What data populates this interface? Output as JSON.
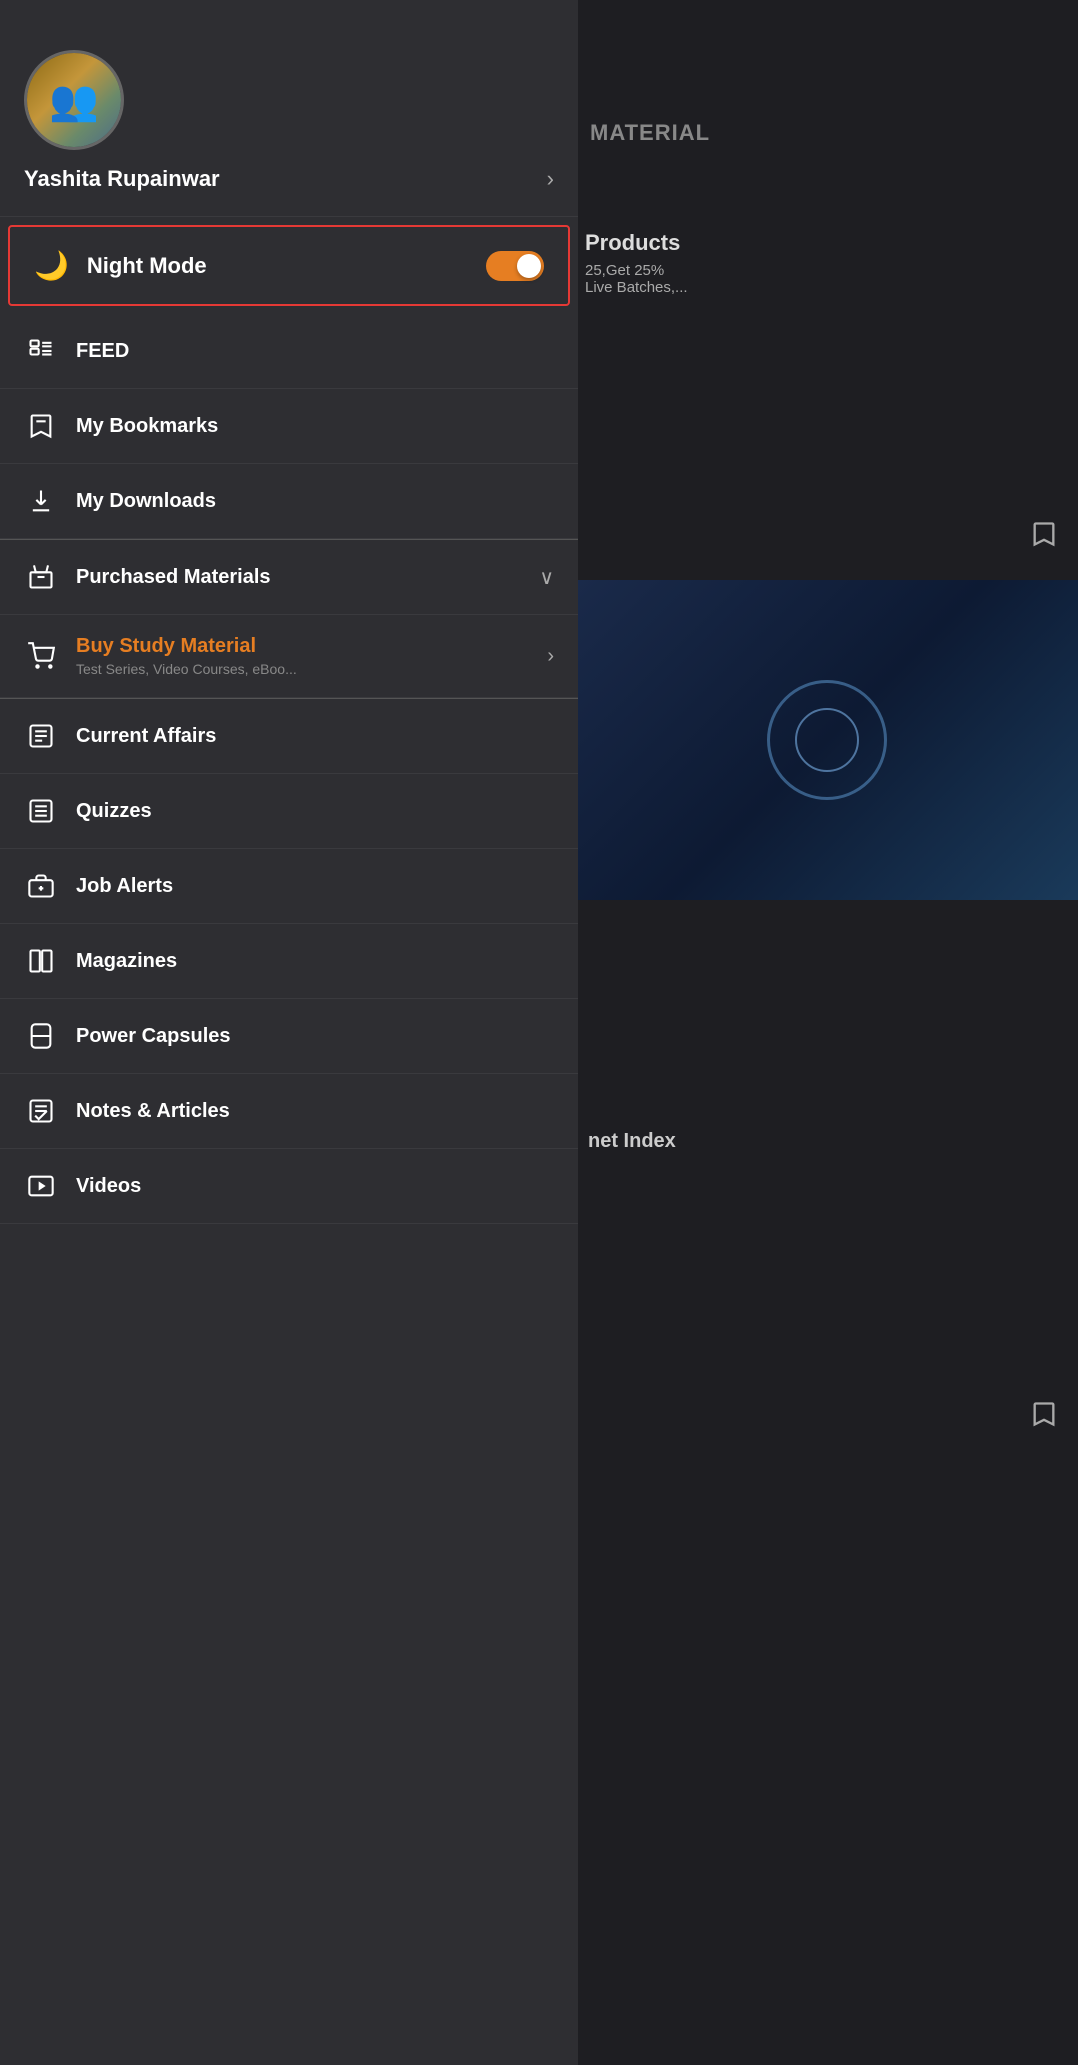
{
  "background": {
    "material_label": "MATERIAL",
    "products_title": "Products",
    "products_subtitle": "25,Get 25%\nLive Batches,...",
    "net_index": "net Index"
  },
  "profile": {
    "name": "Yashita Rupainwar",
    "chevron": "›"
  },
  "night_mode": {
    "label": "Night Mode",
    "toggle_state": "on"
  },
  "menu_items": [
    {
      "id": "feed",
      "label": "FEED",
      "icon": "feed",
      "has_chevron": false
    },
    {
      "id": "bookmarks",
      "label": "My Bookmarks",
      "icon": "bookmark",
      "has_chevron": false
    },
    {
      "id": "downloads",
      "label": "My Downloads",
      "icon": "download",
      "has_chevron": false
    },
    {
      "id": "purchased",
      "label": "Purchased Materials",
      "icon": "bag",
      "has_chevron": true,
      "chevron_type": "down"
    },
    {
      "id": "buy-study",
      "label": "Buy Study Material",
      "icon": "cart",
      "sublabel": "Test Series, Video Courses, eBoo...",
      "has_chevron": true,
      "chevron_type": "right",
      "orange": true
    },
    {
      "id": "current-affairs",
      "label": "Current Affairs",
      "icon": "newspaper",
      "has_chevron": false
    },
    {
      "id": "quizzes",
      "label": "Quizzes",
      "icon": "quiz",
      "has_chevron": false
    },
    {
      "id": "job-alerts",
      "label": "Job Alerts",
      "icon": "briefcase",
      "has_chevron": false
    },
    {
      "id": "magazines",
      "label": "Magazines",
      "icon": "magazine",
      "has_chevron": false
    },
    {
      "id": "power-capsules",
      "label": "Power Capsules",
      "icon": "capsule",
      "has_chevron": false
    },
    {
      "id": "notes-articles",
      "label": "Notes & Articles",
      "icon": "notes",
      "has_chevron": false
    },
    {
      "id": "videos",
      "label": "Videos",
      "icon": "video",
      "has_chevron": false
    }
  ]
}
